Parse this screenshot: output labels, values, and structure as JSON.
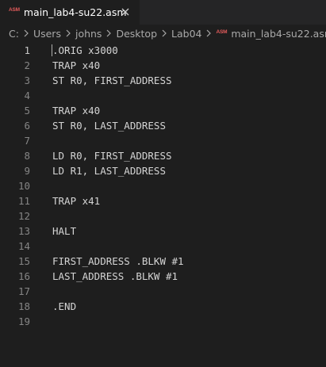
{
  "tab": {
    "icon_text": "ASM",
    "filename": "main_lab4-su22.asm"
  },
  "breadcrumb": {
    "items": [
      "C:",
      "Users",
      "johns",
      "Desktop",
      "Lab04"
    ],
    "file_icon_text": "ASM",
    "file": "main_lab4-su22.asm"
  },
  "editor": {
    "active_line": 1,
    "lines": [
      {
        "num": "1",
        "text": ".ORIG x3000"
      },
      {
        "num": "2",
        "text": "TRAP x40"
      },
      {
        "num": "3",
        "text": "ST R0, FIRST_ADDRESS"
      },
      {
        "num": "4",
        "text": ""
      },
      {
        "num": "5",
        "text": "TRAP x40"
      },
      {
        "num": "6",
        "text": "ST R0, LAST_ADDRESS"
      },
      {
        "num": "7",
        "text": ""
      },
      {
        "num": "8",
        "text": "LD R0, FIRST_ADDRESS"
      },
      {
        "num": "9",
        "text": "LD R1, LAST_ADDRESS"
      },
      {
        "num": "10",
        "text": ""
      },
      {
        "num": "11",
        "text": "TRAP x41"
      },
      {
        "num": "12",
        "text": ""
      },
      {
        "num": "13",
        "text": "HALT"
      },
      {
        "num": "14",
        "text": ""
      },
      {
        "num": "15",
        "text": "FIRST_ADDRESS .BLKW #1"
      },
      {
        "num": "16",
        "text": "LAST_ADDRESS .BLKW #1"
      },
      {
        "num": "17",
        "text": ""
      },
      {
        "num": "18",
        "text": ".END"
      },
      {
        "num": "19",
        "text": ""
      }
    ]
  },
  "colors": {
    "background": "#1e1e1e",
    "tab_bar": "#252526",
    "asm_icon": "#e35b5b",
    "line_number": "#858585",
    "code_text": "#d4d4d4"
  }
}
